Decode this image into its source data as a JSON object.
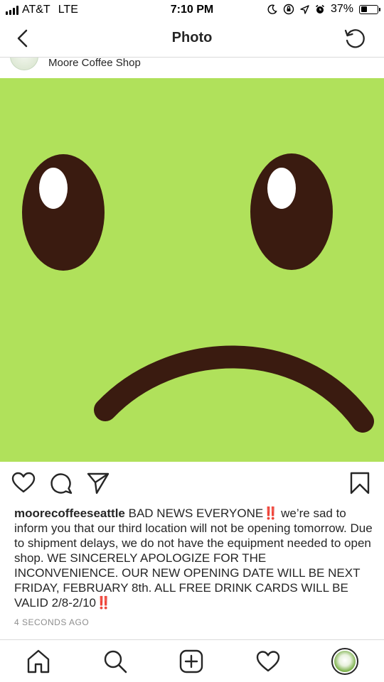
{
  "status_bar": {
    "carrier": "AT&T",
    "network": "LTE",
    "time": "7:10 PM",
    "battery_percent": "37%",
    "battery_level": 0.37
  },
  "nav": {
    "title": "Photo",
    "back_icon": "chevron-left-icon",
    "refresh_icon": "refresh-icon"
  },
  "post": {
    "location": "Moore Coffee Shop",
    "image_colors": {
      "background": "#b0e15b",
      "feature": "#3a1b10",
      "highlight": "#ffffff"
    },
    "caption": {
      "username": "moorecoffeeseattle",
      "part1": "BAD NEWS EVERYONE",
      "emoji1": "‼️",
      "part2": "we’re sad to inform you that our third location will not be opening tomorrow. Due to shipment delays, we do not have the equipment needed to open shop. WE SINCERELY APOLOGIZE FOR THE INCONVENIENCE. OUR NEW OPENING DATE WILL BE NEXT FRIDAY, FEBRUARY 8th. ALL FREE DRINK CARDS WILL BE VALID 2/8-2/10",
      "emoji2": "‼️"
    },
    "timestamp": "4 SECONDS AGO"
  },
  "actions": [
    "heart-icon",
    "comment-icon",
    "share-icon",
    "bookmark-icon"
  ],
  "tab_bar": [
    "home-icon",
    "search-icon",
    "add-post-icon",
    "activity-heart-icon",
    "profile-avatar"
  ]
}
